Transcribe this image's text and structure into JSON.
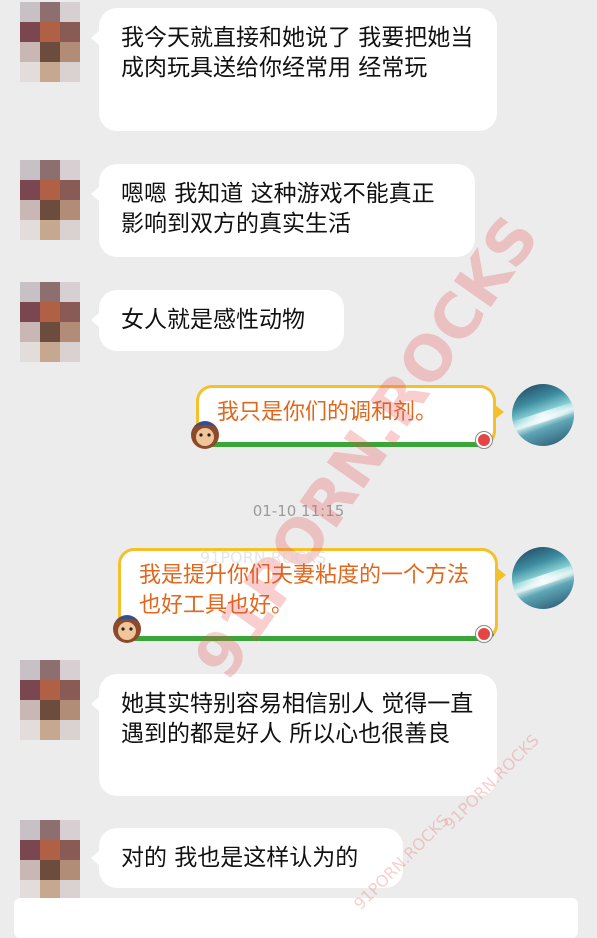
{
  "messages": [
    {
      "side": "left",
      "text": "我今天就直接和她说了  我要把她当成肉玩具送给你经常用  经常玩"
    },
    {
      "side": "left",
      "text": "嗯嗯  我知道  这种游戏不能真正影响到双方的真实生活"
    },
    {
      "side": "left",
      "text": "女人就是感性动物"
    },
    {
      "side": "right",
      "text": "我只是你们的调和剂。"
    },
    {
      "side": "left",
      "text": "她其实特别容易相信别人  觉得一直遇到的都是好人  所以心也很善良"
    },
    {
      "side": "left",
      "text": "对的  我也是这样认为的"
    }
  ],
  "right_message_2": "我是提升你们夫妻粘度的一个方法也好工具也好。",
  "timestamp": "01-10 11:15",
  "watermark": {
    "main": "91PORN.ROCKS",
    "small": "91PORN.ROCKS"
  },
  "colors": {
    "background": "#ececed",
    "bubble_left": "#ffffff",
    "bubble_right_text": "#e0671c",
    "bubble_right_border": "#f4c02b",
    "bubble_right_underline": "#3aa63a"
  }
}
